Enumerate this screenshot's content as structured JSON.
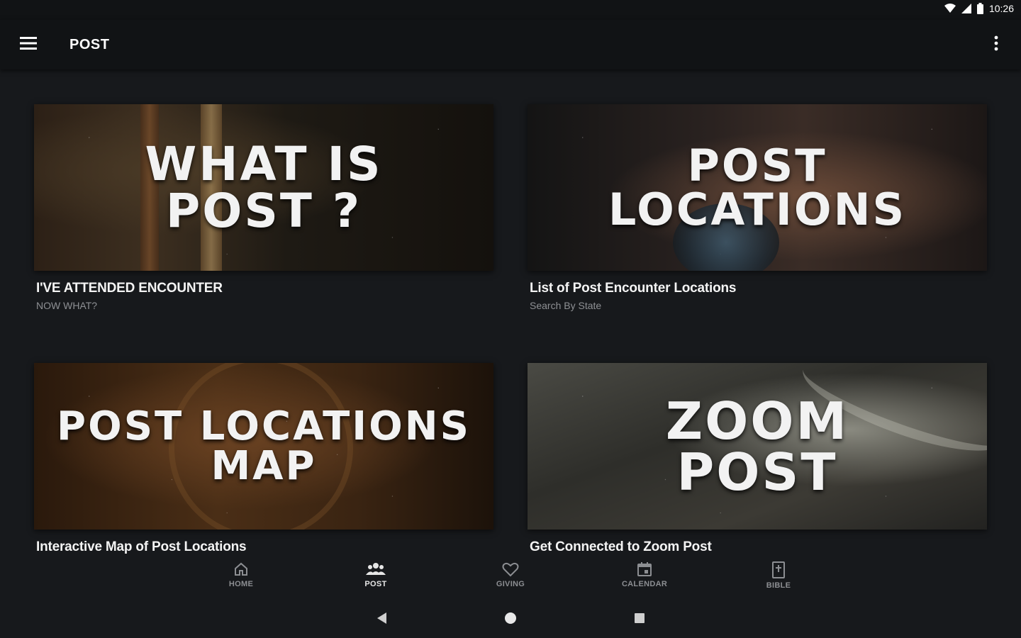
{
  "status_bar": {
    "time": "10:26"
  },
  "app_bar": {
    "title": "POST"
  },
  "cards": [
    {
      "image_text": "WHAT IS\nPOST ?",
      "title": "I'VE ATTENDED ENCOUNTER",
      "subtitle": "NOW WHAT?"
    },
    {
      "image_text": "POST\nLOCATIONS",
      "title": "List of Post Encounter Locations",
      "subtitle": "Search By State"
    },
    {
      "image_text": "POST LOCATIONS\nMAP",
      "title": "Interactive Map of Post Locations",
      "subtitle": ""
    },
    {
      "image_text": "ZOOM\nPOST",
      "title": "Get Connected to Zoom Post",
      "subtitle": ""
    }
  ],
  "bottom_nav": {
    "items": [
      {
        "label": "HOME",
        "icon": "home-icon",
        "active": false
      },
      {
        "label": "POST",
        "icon": "group-icon",
        "active": true
      },
      {
        "label": "GIVING",
        "icon": "heart-icon",
        "active": false
      },
      {
        "label": "CALENDAR",
        "icon": "calendar-icon",
        "active": false
      },
      {
        "label": "BIBLE",
        "icon": "bible-icon",
        "active": false
      }
    ]
  },
  "colors": {
    "background": "#17191c",
    "app_bar": "#111315",
    "subtitle": "#8e9094",
    "nav_inactive": "#8c8e92"
  }
}
